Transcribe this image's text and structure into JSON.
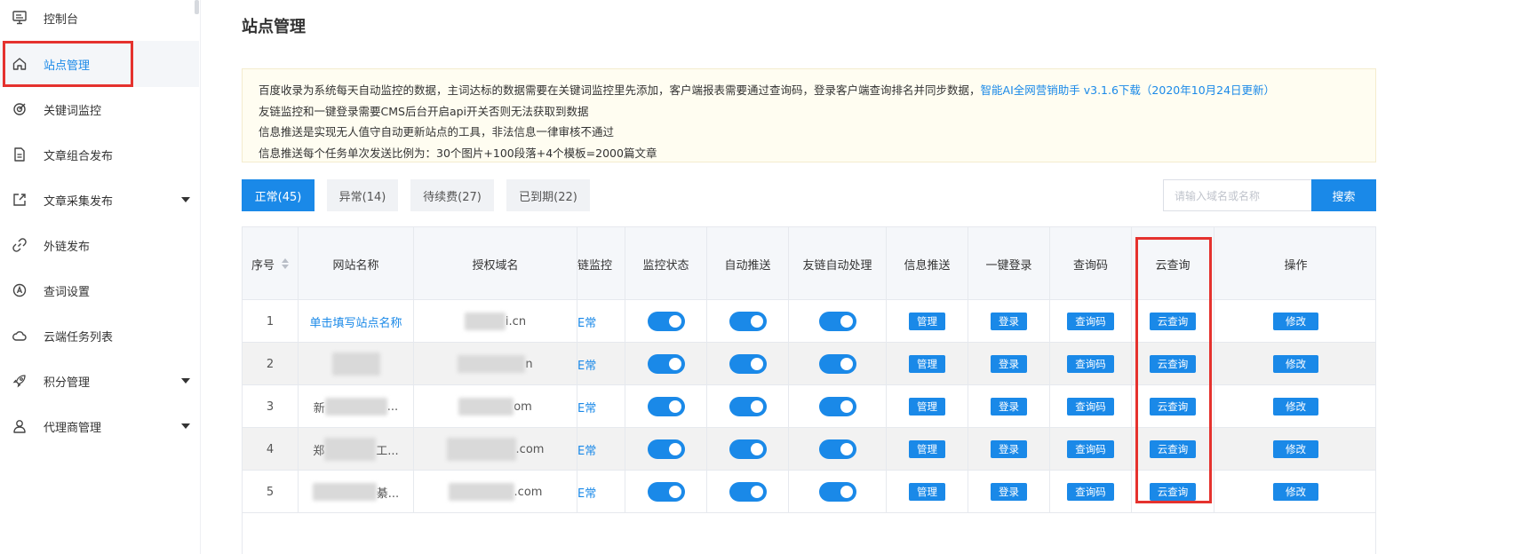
{
  "sidebar": {
    "items": [
      {
        "label": "控制台",
        "icon": "monitor-icon",
        "caret": false
      },
      {
        "label": "站点管理",
        "icon": "home-icon",
        "caret": false,
        "active": true
      },
      {
        "label": "关键词监控",
        "icon": "target-icon",
        "caret": false
      },
      {
        "label": "文章组合发布",
        "icon": "document-icon",
        "caret": false
      },
      {
        "label": "文章采集发布",
        "icon": "external-link-icon",
        "caret": true
      },
      {
        "label": "外链发布",
        "icon": "link-icon",
        "caret": false
      },
      {
        "label": "查词设置",
        "icon": "at-circle-icon",
        "caret": false
      },
      {
        "label": "云端任务列表",
        "icon": "cloud-icon",
        "caret": false
      },
      {
        "label": "积分管理",
        "icon": "rocket-icon",
        "caret": true
      },
      {
        "label": "代理商管理",
        "icon": "user-icon",
        "caret": true
      }
    ]
  },
  "page": {
    "title": "站点管理"
  },
  "notice": {
    "line1": "百度收录为系统每天自动监控的数据，主词达标的数据需要在关键词监控里先添加，客户端报表需要通过查询码，登录客户端查询排名并同步数据，",
    "link": "智能AI全网营销助手 v3.1.6下载（2020年10月24日更新）",
    "line2": "友链监控和一键登录需要CMS后台开启api开关否则无法获取到数据",
    "line3": "信息推送是实现无人值守自动更新站点的工具，非法信息一律审核不通过",
    "line4": "信息推送每个任务单次发送比例为：30个图片+100段落+4个模板=2000篇文章"
  },
  "tabs": [
    {
      "label": "正常(45)",
      "active": true
    },
    {
      "label": "异常(14)",
      "active": false
    },
    {
      "label": "待续费(27)",
      "active": false
    },
    {
      "label": "已到期(22)",
      "active": false
    }
  ],
  "search": {
    "placeholder": "请输入域名或名称",
    "button": "搜索"
  },
  "table": {
    "headers": {
      "index": "序号",
      "name": "网站名称",
      "domain": "授权域名",
      "link_monitor": "链监控",
      "monitor_status": "监控状态",
      "auto_push": "自动推送",
      "friend_link": "友链自动处理",
      "info_push": "信息推送",
      "one_login": "一键登录",
      "query_code": "查询码",
      "cloud_query": "云查询",
      "actions": "操作"
    },
    "buttons": {
      "manage": "管理",
      "login": "登录",
      "query_code": "查询码",
      "cloud_query": "云查询",
      "edit": "修改"
    },
    "rows": [
      {
        "index": "1",
        "name": "单击填写站点名称",
        "domain_suffix": "i.cn",
        "link_status": "E常"
      },
      {
        "index": "2",
        "name": "",
        "domain_suffix": "n",
        "link_status": "E常"
      },
      {
        "index": "3",
        "name_prefix": "新",
        "name_suffix": "...",
        "domain_prefix": "",
        "domain_suffix": "om",
        "link_status": "E常"
      },
      {
        "index": "4",
        "name_prefix": "郑",
        "name_suffix": "工...",
        "domain_prefix": "",
        "domain_suffix": ".com",
        "link_status": "E常"
      },
      {
        "index": "5",
        "name_prefix": "",
        "name_suffix": "綦...",
        "domain_prefix": "",
        "domain_suffix": ".com",
        "link_status": "E常"
      }
    ]
  },
  "colors": {
    "primary": "#1a89e8",
    "highlight": "#e5322e",
    "notice_bg": "#fffdf1"
  }
}
